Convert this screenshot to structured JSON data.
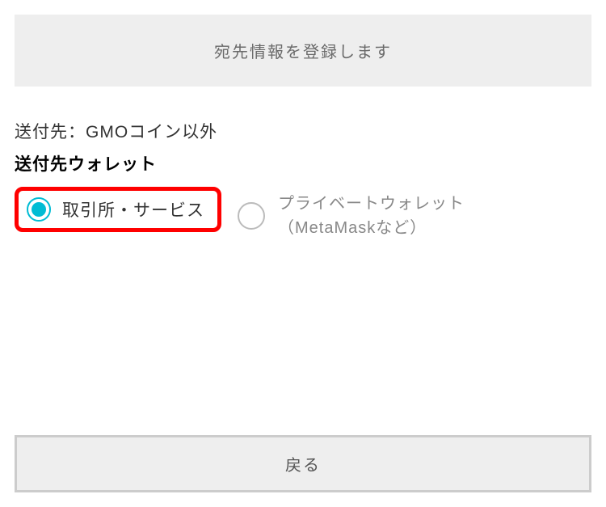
{
  "header": {
    "title": "宛先情報を登録します"
  },
  "destination": {
    "label": "送付先：GMOコイン以外"
  },
  "walletSection": {
    "label": "送付先ウォレット",
    "options": {
      "exchange": "取引所・サービス",
      "private": "プライベートウォレット（MetaMaskなど）"
    }
  },
  "footer": {
    "back": "戻る"
  }
}
